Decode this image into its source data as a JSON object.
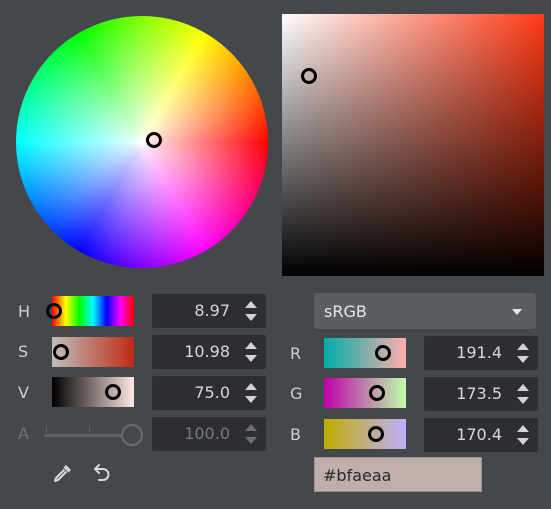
{
  "labels": {
    "h": "H",
    "s": "S",
    "v": "V",
    "a": "A",
    "r": "R",
    "g": "G",
    "b": "B"
  },
  "values": {
    "h": "8.97",
    "s": "10.98",
    "v": "75.0",
    "a": "100.0",
    "r": "191.4",
    "g": "173.5",
    "b": "170.4"
  },
  "color_mode": {
    "selected": "sRGB"
  },
  "hex": "#bfaeaa",
  "colors": {
    "current": "#bfaeaa",
    "hue_pure": "#ff3a16",
    "background": "#45484b"
  },
  "icons": {
    "eyedropper": "eyedropper-icon",
    "reset": "undo-icon",
    "dropdown": "chevron-down-icon"
  },
  "slider_levels": {
    "h": 0.025,
    "s": 0.11,
    "v": 0.75,
    "a": 1.0,
    "r": 0.75,
    "g": 0.68,
    "b": 0.67
  }
}
